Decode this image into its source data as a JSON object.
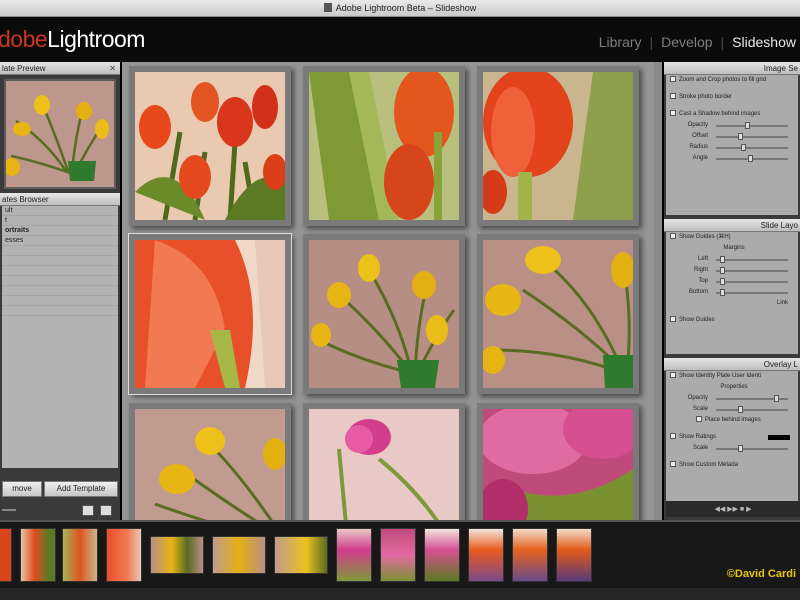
{
  "window": {
    "title": "Adobe Lightroom Beta – Slideshow"
  },
  "app": {
    "logo_adobe": "dobe",
    "logo_name": "Lightroom"
  },
  "modules": [
    {
      "label": "Library",
      "active": false
    },
    {
      "label": "Develop",
      "active": false
    },
    {
      "label": "Slideshow",
      "active": true
    }
  ],
  "left": {
    "preview_title": "late Preview",
    "browser_title": "ates Browser",
    "templates": [
      "ult",
      "t",
      "ortraits",
      "esses",
      "",
      "",
      "",
      "",
      "",
      "",
      ""
    ],
    "btn_remove": "move",
    "btn_add": "Add Template"
  },
  "right": {
    "image_settings": "Image Se",
    "zoom_label": "Zoom and Crop photos to fill grid",
    "stroke_label": "Stroke photo border",
    "shadow_label": "Cast a Shadow behind images",
    "opacity": "Opacity",
    "offset": "Offset",
    "radius": "Radius",
    "angle": "Angle",
    "slide_layout": "Slide Layo",
    "show_guides_link": "Show Guides (⌘H)",
    "margins": "Margins",
    "left": "Left",
    "right": "Right",
    "top": "Top",
    "bottom": "Bottom",
    "link_all": "Link",
    "show_guides": "Show Guides",
    "overlays": "Overlay L",
    "identity_plate": "Show Identity Plate",
    "user_identity": "User Identi",
    "properties": "Properties",
    "opacity2": "Opacity",
    "scale": "Scale",
    "place_behind": "Place behind images",
    "show_ratings": "Show Ratings",
    "scale2": "Scale",
    "custom_metadata": "Show Custom Metada",
    "play_controls": "◀◀  ▶▶  ■  ▶",
    "ratings_color": "#000000"
  },
  "filmstrip": {
    "copyright": "©David Cardi"
  },
  "colors": {
    "accent": "#c8371f",
    "copyright": "#e8c60a"
  }
}
